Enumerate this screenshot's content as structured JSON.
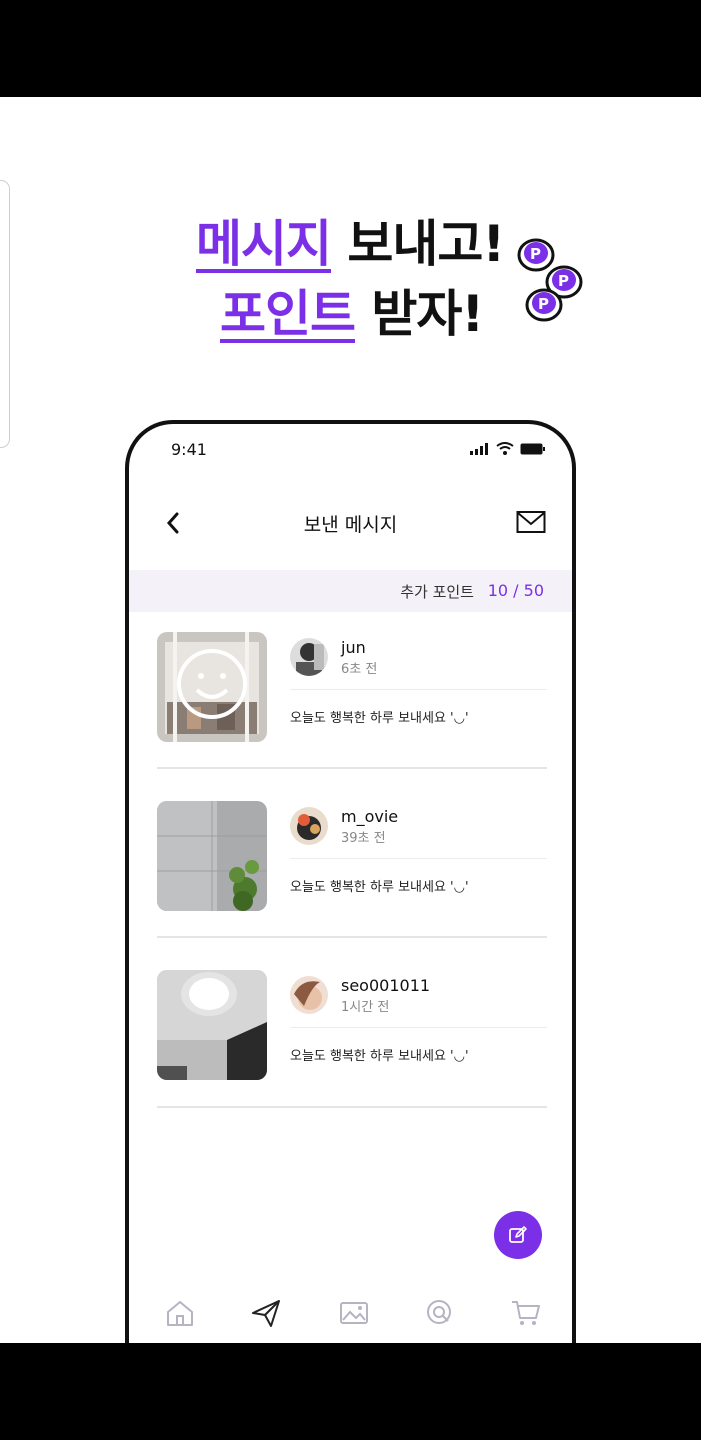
{
  "headline": {
    "line1_accent": "메시지",
    "line1_rest": " 보내고!",
    "line2_accent": "포인트",
    "line2_rest": " 받자!"
  },
  "status_bar": {
    "time": "9:41"
  },
  "header": {
    "title": "보낸 메시지"
  },
  "points": {
    "label": "추가 포인트",
    "value": "10 / 50"
  },
  "messages": [
    {
      "username": "jun",
      "time": "6초 전",
      "text": "오늘도 행복한 하루 보내세요 '◡'"
    },
    {
      "username": "m_ovie",
      "time": "39초 전",
      "text": "오늘도 행복한 하루 보내세요 '◡'"
    },
    {
      "username": "seo001011",
      "time": "1시간 전",
      "text": "오늘도 행복한 하루 보내세요 '◡'"
    }
  ],
  "tabs": [
    "home-icon",
    "send-icon",
    "gallery-icon",
    "search-icon",
    "cart-icon"
  ],
  "colors": {
    "accent": "#7b2fe6",
    "text": "#111111",
    "muted": "#888888",
    "points_bg": "#f4f2f8"
  }
}
